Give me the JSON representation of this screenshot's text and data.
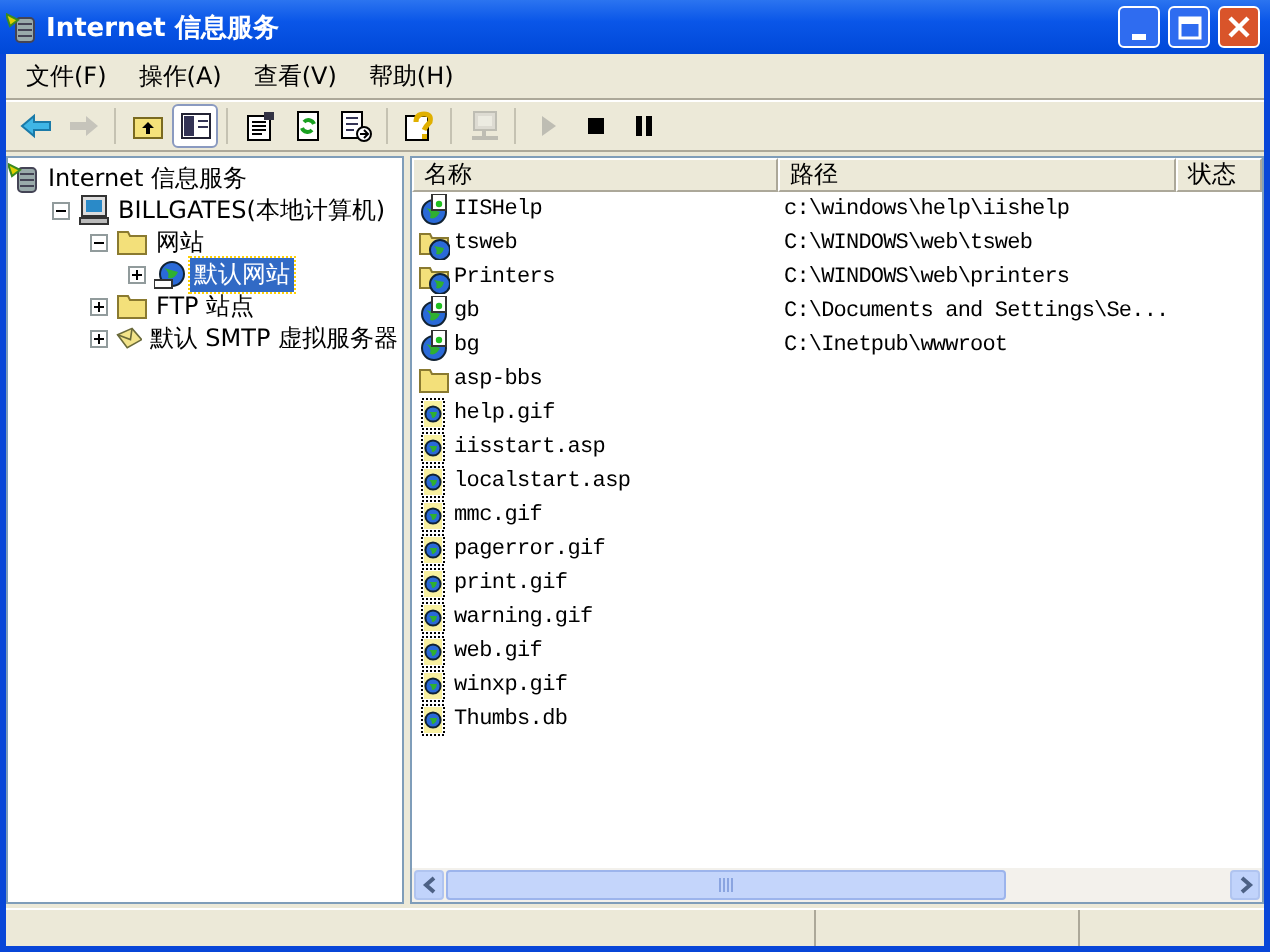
{
  "window": {
    "title": "Internet 信息服务"
  },
  "menu": [
    "文件(F)",
    "操作(A)",
    "查看(V)",
    "帮助(H)"
  ],
  "toolbar": [
    {
      "kind": "back",
      "disabled": false,
      "pressed": false
    },
    {
      "kind": "forward",
      "disabled": true,
      "pressed": false
    },
    {
      "kind": "separator"
    },
    {
      "kind": "up",
      "disabled": false,
      "pressed": false
    },
    {
      "kind": "tree",
      "disabled": false,
      "pressed": true
    },
    {
      "kind": "separator"
    },
    {
      "kind": "properties",
      "disabled": false,
      "pressed": false
    },
    {
      "kind": "refresh",
      "disabled": false,
      "pressed": false
    },
    {
      "kind": "export",
      "disabled": false,
      "pressed": false
    },
    {
      "kind": "separator"
    },
    {
      "kind": "help",
      "disabled": false,
      "pressed": false
    },
    {
      "kind": "separator"
    },
    {
      "kind": "computer",
      "disabled": true,
      "pressed": false
    },
    {
      "kind": "separator"
    },
    {
      "kind": "play",
      "disabled": true,
      "pressed": false
    },
    {
      "kind": "stop",
      "disabled": false,
      "pressed": false
    },
    {
      "kind": "pause",
      "disabled": false,
      "pressed": false
    }
  ],
  "tree": [
    {
      "label": "Internet 信息服务",
      "kind": "server",
      "selected": false,
      "children": [
        {
          "label": "BILLGATES(本地计算机)",
          "kind": "computer",
          "expanded": true,
          "selected": false,
          "children": [
            {
              "label": "网站",
              "kind": "folder",
              "expanded": true,
              "selected": false,
              "children": [
                {
                  "label": "默认网站",
                  "kind": "site",
                  "expanded": false,
                  "selected": true,
                  "has_children": true
                }
              ]
            },
            {
              "label": "FTP 站点",
              "kind": "folder",
              "expanded": false,
              "selected": false,
              "has_children": true
            },
            {
              "label": "默认 SMTP 虚拟服务器",
              "kind": "mail",
              "expanded": false,
              "selected": false,
              "has_children": true
            }
          ]
        }
      ]
    }
  ],
  "table": {
    "columns": [
      "名称",
      "路径",
      "状态"
    ],
    "rows": [
      {
        "name": "IISHelp",
        "path": "c:\\windows\\help\\iishelp",
        "kind": "app"
      },
      {
        "name": "tsweb",
        "path": "C:\\WINDOWS\\web\\tsweb",
        "kind": "vdir"
      },
      {
        "name": "Printers",
        "path": "C:\\WINDOWS\\web\\printers",
        "kind": "vdir"
      },
      {
        "name": "gb",
        "path": "C:\\Documents and Settings\\Se...",
        "kind": "app"
      },
      {
        "name": "bg",
        "path": "C:\\Inetpub\\wwwroot",
        "kind": "app"
      },
      {
        "name": "asp-bbs",
        "kind": "folder"
      },
      {
        "name": "help.gif",
        "kind": "file"
      },
      {
        "name": "iisstart.asp",
        "kind": "file"
      },
      {
        "name": "localstart.asp",
        "kind": "file"
      },
      {
        "name": "mmc.gif",
        "kind": "file"
      },
      {
        "name": "pagerror.gif",
        "kind": "file"
      },
      {
        "name": "print.gif",
        "kind": "file"
      },
      {
        "name": "warning.gif",
        "kind": "file"
      },
      {
        "name": "web.gif",
        "kind": "file"
      },
      {
        "name": "winxp.gif",
        "kind": "file"
      },
      {
        "name": "Thumbs.db",
        "kind": "file"
      }
    ]
  }
}
